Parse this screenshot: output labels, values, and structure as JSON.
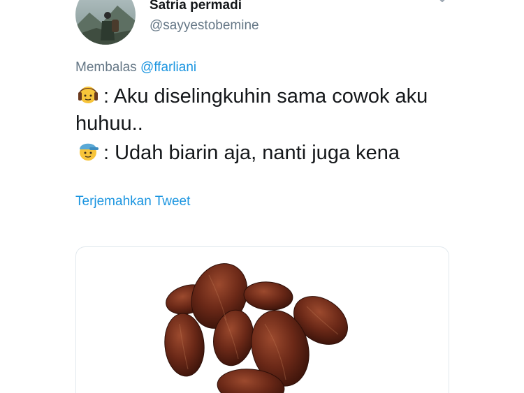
{
  "tweet": {
    "author": {
      "display_name": "Satria permadi",
      "handle": "@sayyestobemine",
      "avatar_icon": "profile-photo-hiker"
    },
    "reply": {
      "prefix": "Membalas",
      "mention": "@ffarliani"
    },
    "lines": [
      {
        "emoji_icon": "girl-emoji",
        "text": ": Aku diselingkuhin sama cowok aku"
      },
      {
        "emoji_icon": "",
        "text": "huhuu.."
      },
      {
        "emoji_icon": "boy-cap-emoji",
        "text": ": Udah biarin aja, nanti juga kena"
      }
    ],
    "translate_label": "Terjemahkan Tweet",
    "media": {
      "description_icon": "dates-fruit-image"
    }
  },
  "colors": {
    "link": "#1b95e0",
    "secondary_text": "#657786",
    "primary_text": "#14171a",
    "card_border": "#e1e8ed"
  }
}
